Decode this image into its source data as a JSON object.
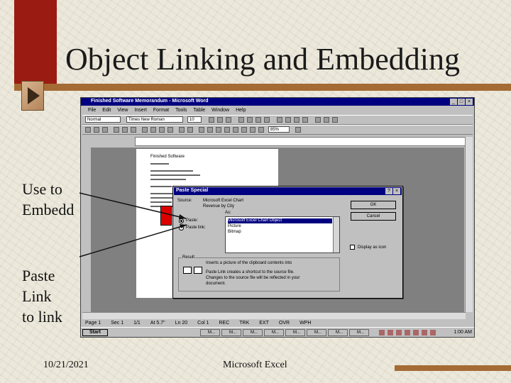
{
  "slide": {
    "title": "Object Linking and Embedding",
    "label_embed": [
      "Use to",
      "Embedd"
    ],
    "label_link": [
      "Paste",
      "Link",
      "to link"
    ],
    "footer_date": "10/21/2021",
    "footer_center": "Microsoft Excel",
    "colors": {
      "bar": "#9a1b12",
      "rule": "#a46b35",
      "background": "#ece9dc"
    }
  },
  "word": {
    "title": "Finished Software Memorandum - Microsoft Word",
    "window_buttons": [
      "_",
      "□",
      "×"
    ],
    "menu": [
      "File",
      "Edit",
      "View",
      "Insert",
      "Format",
      "Tools",
      "Table",
      "Window",
      "Help"
    ],
    "style_combo": "Normal",
    "font_combo": "Times New Roman",
    "size_combo": "10",
    "zoom_combo": "85%",
    "page_heading": "Finished Software",
    "status": [
      "Page 1",
      "Sec 1",
      "1/1",
      "At 5.7\"",
      "Ln 20",
      "Col 1",
      "REC",
      "TRK",
      "EXT",
      "OVR",
      "WPH"
    ],
    "taskbar": {
      "start": "Start",
      "clock": "1:00 AM",
      "items": [
        "M...",
        "M...",
        "M...",
        "M...",
        "M...",
        "M...",
        "M...",
        "M..."
      ]
    }
  },
  "dialog": {
    "title": "Paste Special",
    "source_label": "Source:",
    "source_value": "Microsoft Excel Chart",
    "source_path": "Revenue by City",
    "as_label": "As:",
    "paste_label": "Paste:",
    "paste_link_label": "Paste link:",
    "as_options": [
      "Microsoft Excel Chart Object",
      "Picture",
      "Bitmap"
    ],
    "ok_label": "OK",
    "cancel_label": "Cancel",
    "display_icon_label": "Display as icon",
    "result_label": "Result",
    "result_line1": "Inserts a picture of the clipboard contents into",
    "result_line2": "Paste Link creates a shortcut to the source file.",
    "result_line3": "Changes to the source file will be reflected in your",
    "result_line4": "document."
  }
}
